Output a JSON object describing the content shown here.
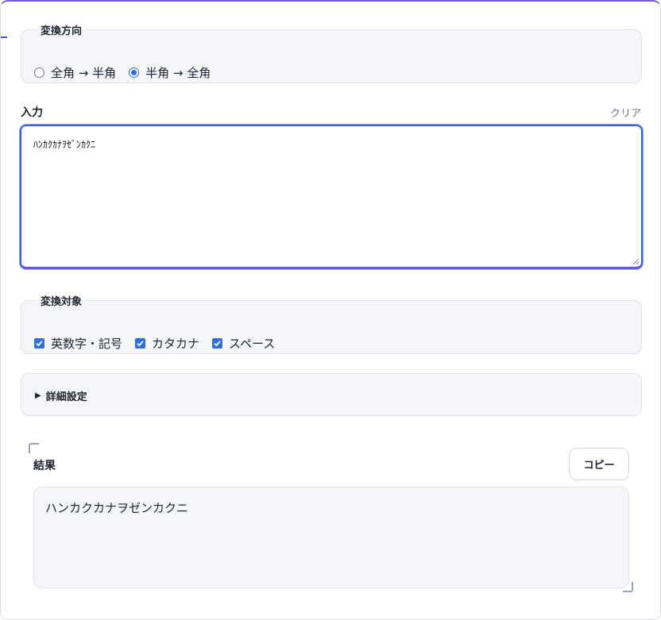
{
  "direction": {
    "legend": "変換方向",
    "options": [
      {
        "label": "全角 → 半角",
        "selected": false
      },
      {
        "label": "半角 → 全角",
        "selected": true
      }
    ]
  },
  "input": {
    "label": "入力",
    "clear_label": "クリア",
    "value": "ﾊﾝｶｸｶﾅｦｾﾞﾝｶｸﾆ"
  },
  "targets": {
    "legend": "変換対象",
    "options": [
      {
        "label": "英数字・記号",
        "checked": true
      },
      {
        "label": "カタカナ",
        "checked": true
      },
      {
        "label": "スペース",
        "checked": true
      }
    ]
  },
  "details": {
    "summary": "詳細設定",
    "collapsed_icon": "triangle-right-icon"
  },
  "result": {
    "label": "結果",
    "copy_label": "コピー",
    "value": "ハンカクカナヲゼンカクニ"
  },
  "colors": {
    "accent": "#2f6fe0",
    "focus_border": "#3b63d4",
    "top_border": "#6b5fd1",
    "panel_bg": "#f5f6fa"
  }
}
